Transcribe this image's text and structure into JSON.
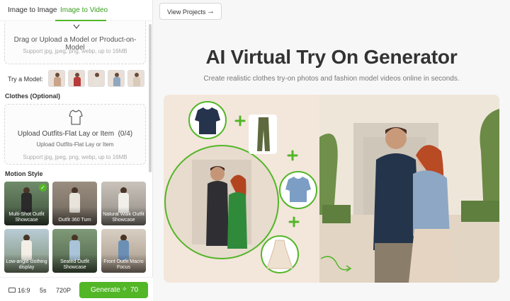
{
  "tabs": {
    "image_to_image": "Image to Image",
    "image_to_video": "Image to Video"
  },
  "upload_model": {
    "title": "Drag or Upload a Model or Product-on-Model",
    "formats": "Support jpg, jpeg, png, webp, up to 16MB"
  },
  "try_model": {
    "label": "Try a Model:"
  },
  "clothes": {
    "label": "Clothes (Optional)",
    "title": "Upload Outfits-Flat Lay or Item  (0/4)",
    "subtitle": "Upload Outfits-Flat Lay or Item",
    "formats": "Support jpg, jpeg, png, webp, up to 16MB"
  },
  "motion_style": {
    "label": "Motion Style",
    "items": [
      {
        "label": "Multi-Shot Outfit Showcase",
        "selected": true
      },
      {
        "label": "Outfit 360 Turn",
        "selected": false
      },
      {
        "label": "Natural Walk Outfit Showcase",
        "selected": false
      },
      {
        "label": "Low-angle clothing display",
        "selected": false
      },
      {
        "label": "Seated Outfit Showcase",
        "selected": false
      },
      {
        "label": "Front Outfit Macro Focus",
        "selected": false
      }
    ]
  },
  "bottom": {
    "ratio": "16:9",
    "duration": "5s",
    "resolution": "720P",
    "generate": "Generate",
    "cost": "70"
  },
  "header": {
    "view_projects": "View Projects"
  },
  "hero": {
    "title": "AI Virtual Try On Generator",
    "subtitle": "Create realistic clothes try-on photos and fashion model videos online in seconds."
  },
  "colors": {
    "accent": "#52b627",
    "accent_text": "#3a9d1f"
  }
}
